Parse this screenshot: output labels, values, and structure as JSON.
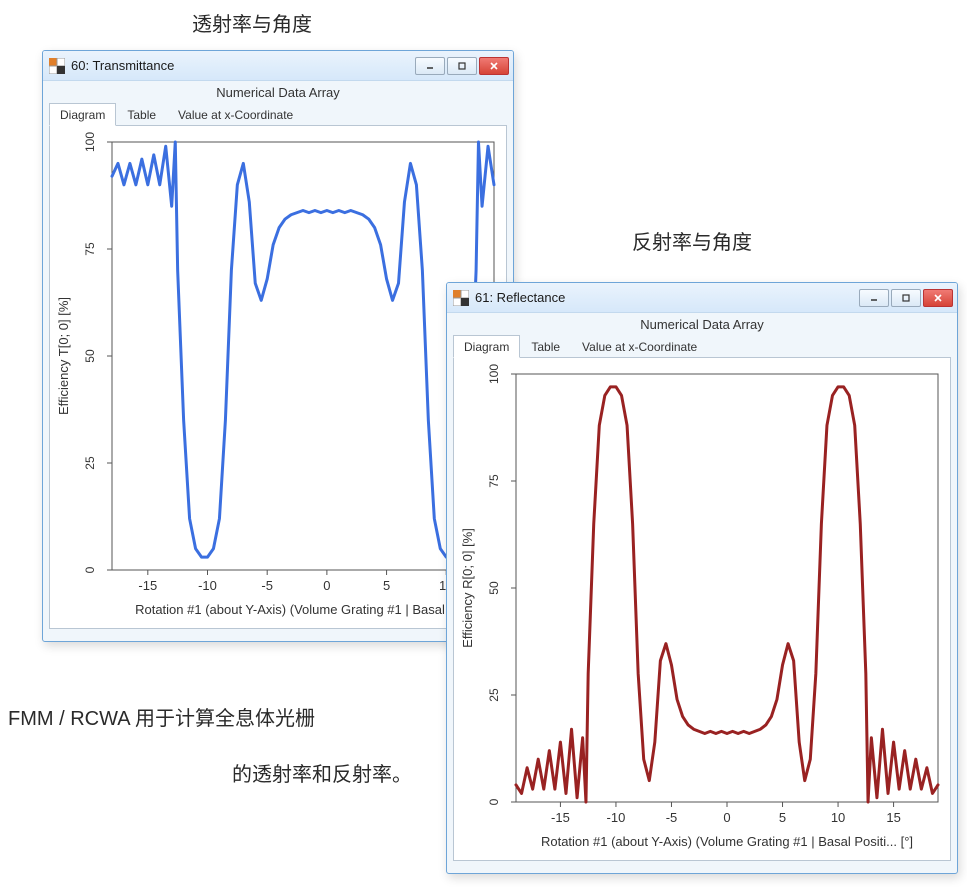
{
  "labels": {
    "top_trans": "透射率与角度",
    "top_refl": "反射率与角度",
    "caption_line1": "FMM / RCWA  用于计算全息体光栅",
    "caption_line2": "的透射率和反射率。"
  },
  "window_trans": {
    "title": "60: Transmittance",
    "subtitle": "Numerical Data Array",
    "tabs": [
      "Diagram",
      "Table",
      "Value at x-Coordinate"
    ],
    "active_tab": 0,
    "xlabel": "Rotation #1 (about Y-Axis) (Volume Grating #1 | Basal Pos",
    "ylabel": "Efficiency T[0; 0] [%]"
  },
  "window_refl": {
    "title": "61: Reflectance",
    "subtitle": "Numerical Data Array",
    "tabs": [
      "Diagram",
      "Table",
      "Value at x-Coordinate"
    ],
    "active_tab": 0,
    "xlabel": "Rotation #1 (about Y-Axis) (Volume Grating #1 | Basal Positi... [°]",
    "ylabel": "Efficiency R[0; 0] [%]"
  },
  "colors": {
    "trans_line": "#3b6fe0",
    "refl_line": "#992222"
  },
  "chart_data": [
    {
      "id": "transmittance",
      "type": "line",
      "title": "Transmittance",
      "xlabel": "Rotation #1 about Y-Axis (Volume Grating #1, Basal Position) [°]",
      "ylabel": "Efficiency T[0;0] [%]",
      "xlim": [
        -18,
        14
      ],
      "ylim": [
        0,
        100
      ],
      "yticks": [
        0,
        25,
        50,
        75,
        100
      ],
      "xticks": [
        -15,
        -10,
        -5,
        0,
        5,
        10
      ],
      "series": [
        {
          "name": "T[0;0]",
          "color": "#3b6fe0",
          "x": [
            -18,
            -17.5,
            -17,
            -16.5,
            -16,
            -15.5,
            -15,
            -14.5,
            -14,
            -13.5,
            -13,
            -12.7,
            -12.5,
            -12,
            -11.5,
            -11,
            -10.5,
            -10,
            -9.5,
            -9,
            -8.5,
            -8,
            -7.5,
            -7,
            -6.5,
            -6,
            -5.5,
            -5,
            -4.5,
            -4,
            -3.5,
            -3,
            -2.5,
            -2,
            -1.5,
            -1,
            -0.5,
            0,
            0.5,
            1,
            1.5,
            2,
            2.5,
            3,
            3.5,
            4,
            4.5,
            5,
            5.5,
            6,
            6.5,
            7,
            7.5,
            8,
            8.5,
            9,
            9.5,
            10,
            10.5,
            11,
            11.5,
            12,
            12.5,
            12.7,
            13,
            13.5,
            14
          ],
          "y": [
            92,
            95,
            90,
            95,
            90,
            96,
            90,
            97,
            90,
            99,
            85,
            100,
            70,
            35,
            12,
            5,
            3,
            3,
            5,
            12,
            35,
            70,
            90,
            95,
            86,
            67,
            63,
            68,
            76,
            80,
            82,
            83,
            83.5,
            84,
            83.5,
            84,
            83.5,
            84,
            83.5,
            84,
            83.5,
            84,
            83.5,
            83,
            82,
            80,
            76,
            68,
            63,
            67,
            86,
            95,
            90,
            70,
            35,
            12,
            5,
            3,
            3,
            5,
            12,
            35,
            70,
            100,
            85,
            99,
            90
          ]
        }
      ]
    },
    {
      "id": "reflectance",
      "type": "line",
      "title": "Reflectance",
      "xlabel": "Rotation #1 about Y-Axis (Volume Grating #1, Basal Position) [°]",
      "ylabel": "Efficiency R[0;0] [%]",
      "xlim": [
        -19,
        19
      ],
      "ylim": [
        0,
        100
      ],
      "yticks": [
        0,
        25,
        50,
        75,
        100
      ],
      "xticks": [
        -15,
        -10,
        -5,
        0,
        5,
        10,
        15
      ],
      "series": [
        {
          "name": "R[0;0]",
          "color": "#992222",
          "x": [
            -19,
            -18.5,
            -18,
            -17.5,
            -17,
            -16.5,
            -16,
            -15.5,
            -15,
            -14.5,
            -14,
            -13.5,
            -13,
            -12.7,
            -12.5,
            -12,
            -11.5,
            -11,
            -10.5,
            -10,
            -9.5,
            -9,
            -8.5,
            -8,
            -7.5,
            -7,
            -6.5,
            -6,
            -5.5,
            -5,
            -4.5,
            -4,
            -3.5,
            -3,
            -2.5,
            -2,
            -1.5,
            -1,
            -0.5,
            0,
            0.5,
            1,
            1.5,
            2,
            2.5,
            3,
            3.5,
            4,
            4.5,
            5,
            5.5,
            6,
            6.5,
            7,
            7.5,
            8,
            8.5,
            9,
            9.5,
            10,
            10.5,
            11,
            11.5,
            12,
            12.5,
            12.7,
            13,
            13.5,
            14,
            14.5,
            15,
            15.5,
            16,
            16.5,
            17,
            17.5,
            18,
            18.5,
            19
          ],
          "y": [
            4,
            2,
            8,
            3,
            10,
            3,
            12,
            3,
            14,
            2,
            17,
            1,
            15,
            0,
            30,
            65,
            88,
            95,
            97,
            97,
            95,
            88,
            65,
            30,
            10,
            5,
            14,
            33,
            37,
            32,
            24,
            20,
            18,
            17,
            16.5,
            16,
            16.5,
            16,
            16.5,
            16,
            16.5,
            16,
            16.5,
            16,
            16.5,
            17,
            18,
            20,
            24,
            32,
            37,
            33,
            14,
            5,
            10,
            30,
            65,
            88,
            95,
            97,
            97,
            95,
            88,
            65,
            30,
            0,
            15,
            1,
            17,
            2,
            14,
            3,
            12,
            3,
            10,
            3,
            8,
            2,
            4
          ]
        }
      ]
    }
  ]
}
